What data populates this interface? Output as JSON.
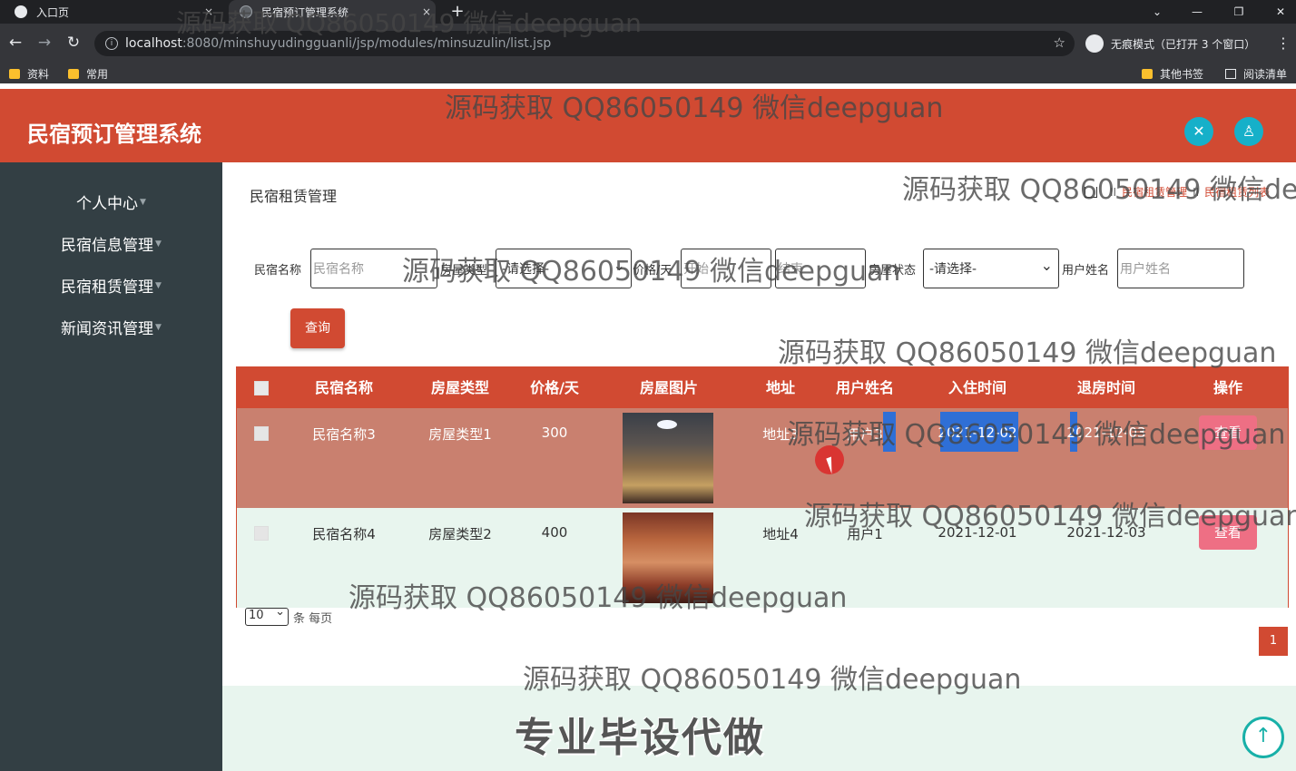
{
  "browser": {
    "tabs": [
      {
        "title": "入口页",
        "close": "×"
      },
      {
        "title": "民宿预订管理系统",
        "close": "×"
      }
    ],
    "new_tab": "+",
    "url_host": "localhost",
    "url_path": ":8080/minshuyudingguanli/jsp/modules/minsuzulin/list.jsp",
    "incognito_label": "无痕模式（已打开 3 个窗口）",
    "bookmarks": [
      "资料",
      "常用"
    ],
    "bookmarks_right": [
      "其他书签",
      "阅读清单"
    ]
  },
  "app": {
    "title": "民宿预订管理系统",
    "header_icons": [
      "fullscreen-icon",
      "user-icon"
    ]
  },
  "sidebar": {
    "items": [
      {
        "label": "个人中心"
      },
      {
        "label": "民宿信息管理"
      },
      {
        "label": "民宿租赁管理"
      },
      {
        "label": "新闻资讯管理"
      }
    ]
  },
  "page": {
    "title": "民宿租赁管理",
    "breadcrumb": [
      "民宿租赁管理",
      "民宿租赁列表"
    ]
  },
  "filters": {
    "name_label": "民宿名称",
    "name_placeholder": "民宿名称",
    "type_label": "房屋类型",
    "type_value": "-请选择-",
    "price_label": "价格/天",
    "price_start_placeholder": "开始",
    "price_end_placeholder": "结束",
    "status_label": "房屋状态",
    "status_value": "-请选择-",
    "user_label": "用户姓名",
    "user_placeholder": "用户姓名",
    "query_button": "查询"
  },
  "table": {
    "columns": [
      "民宿名称",
      "房屋类型",
      "价格/天",
      "房屋图片",
      "地址",
      "用户姓名",
      "入住时间",
      "退房时间",
      "操作"
    ],
    "rows": [
      {
        "name": "民宿名称3",
        "type": "房屋类型1",
        "price": "300",
        "address": "地址3",
        "user": "用户3",
        "checkin": "2021-12-02",
        "checkout": "2021-12-03",
        "action": "查看"
      },
      {
        "name": "民宿名称4",
        "type": "房屋类型2",
        "price": "400",
        "address": "地址4",
        "user": "用户1",
        "checkin": "2021-12-01",
        "checkout": "2021-12-03",
        "action": "查看"
      }
    ]
  },
  "pager": {
    "page_size": "10",
    "page_size_suffix": "条 每页",
    "current_page": "1"
  },
  "overlay": {
    "watermark": "源码获取 QQ86050149 微信deepguan",
    "banner": "专业毕设代做"
  },
  "colors": {
    "brand": "#d14a32",
    "sidebar": "#333f44",
    "accent_cyan": "#16b0c9",
    "view_button": "#ee6f84"
  }
}
